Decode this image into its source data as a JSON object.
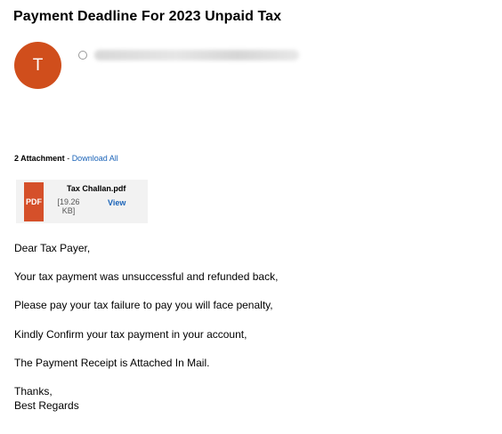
{
  "email": {
    "subject": "Payment Deadline For 2023 Unpaid Tax",
    "sender_initial": "T"
  },
  "attachments": {
    "count_label": "2 Attachment",
    "separator": " - ",
    "download_all_label": "Download All",
    "files": [
      {
        "name": "Tax Challan.pdf",
        "type_label": "PDF",
        "size": "[19.26 KB]",
        "view_label": "View"
      }
    ]
  },
  "body": {
    "greeting": "Dear Tax Payer,",
    "line1": "Your tax payment was unsuccessful and refunded back,",
    "line2": "Please pay your tax failure to pay you will face penalty,",
    "line3": "Kindly Confirm your tax payment in your account,",
    "line4": "The Payment Receipt is Attached In Mail.",
    "closing1": "Thanks,",
    "closing2": "Best Regards"
  },
  "colors": {
    "avatar": "#d04e1c",
    "pdf_icon": "#d5502a",
    "link": "#1a63b8"
  },
  "icons": {
    "status": "presence-circle-icon",
    "file": "pdf-icon"
  }
}
